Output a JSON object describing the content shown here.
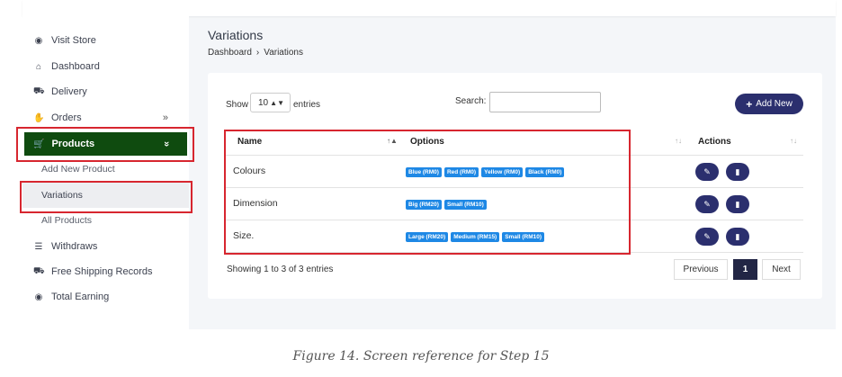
{
  "sidebar": {
    "visit_store": "Visit Store",
    "dashboard": "Dashboard",
    "delivery": "Delivery",
    "orders": "Orders",
    "orders_chevron": "»",
    "products": "Products",
    "products_chevron": "»",
    "add_new_product": "Add New Product",
    "variations": "Variations",
    "all_products": "All Products",
    "withdraws": "Withdraws",
    "free_shipping_records": "Free Shipping Records",
    "total_earning": "Total Earning",
    "icons": [
      "eye-icon",
      "home-icon",
      "truck-icon",
      "hand-icon",
      "cart-icon",
      "list-icon",
      "truck-icon",
      "eye-icon"
    ]
  },
  "header": {
    "title": "Variations",
    "breadcrumb": [
      "Dashboard",
      "›",
      "Variations"
    ]
  },
  "table_controls": {
    "show_label": "Show",
    "page_length": "10",
    "entries_label": "entries",
    "search_label": "Search:",
    "search_value": "",
    "add_button": "Add New"
  },
  "table": {
    "columns": [
      "Name",
      "Options",
      "Actions"
    ],
    "rows": [
      {
        "name": "Colours",
        "options": [
          "Blue (RM0)",
          "Red (RM0)",
          "Yellow (RM0)",
          "Black (RM0)"
        ]
      },
      {
        "name": "Dimension",
        "options": [
          "Big (RM20)",
          "Small (RM10)"
        ]
      },
      {
        "name": "Size.",
        "options": [
          "Large (RM20)",
          "Medium (RM15)",
          "Small (RM10)"
        ]
      }
    ]
  },
  "footer": {
    "info": "Showing 1 to 3 of 3 entries",
    "previous": "Previous",
    "page": "1",
    "next": "Next"
  },
  "caption": "Figure 14. Screen reference for Step 15",
  "colors": {
    "products_bg": "#0f4b0f",
    "primary_button": "#2b2f6e",
    "tag": "#1e88e5",
    "highlight_border": "#d7262f"
  }
}
